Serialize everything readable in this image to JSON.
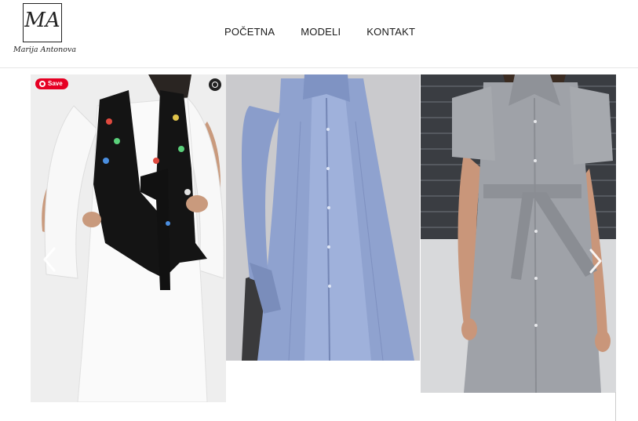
{
  "brand": {
    "monogram": "MA",
    "name": "Marija Antonova"
  },
  "nav": {
    "items": [
      {
        "label": "POČETNA"
      },
      {
        "label": "MODELI"
      },
      {
        "label": "KONTAKT"
      }
    ]
  },
  "gallery": {
    "pin_label": "Save",
    "photos": [
      {
        "subject": "white shirt dress with embroidered black vest"
      },
      {
        "subject": "light blue pleated shirt dress"
      },
      {
        "subject": "grey belted shirt dress"
      }
    ]
  },
  "colors": {
    "pinterest": "#e60023",
    "nav_text": "#1a1a1a"
  },
  "icons": {
    "prev": "chevron-left-icon",
    "next": "chevron-right-icon",
    "zoom": "zoom-icon",
    "pin": "pinterest-icon"
  }
}
